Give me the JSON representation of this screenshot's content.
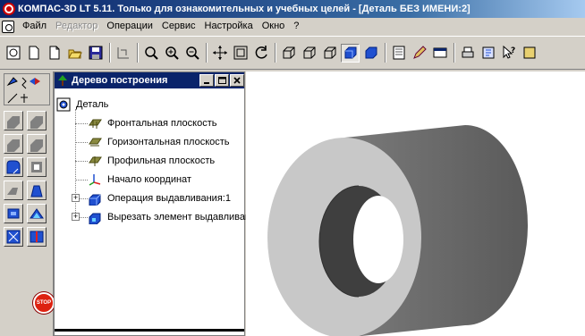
{
  "window": {
    "title": "КОМПАС-3D LT 5.11. Только для ознакомительных и учебных целей - [Деталь БЕЗ ИМЕНИ:2]",
    "app_icon": "kompas-logo-icon"
  },
  "menu": {
    "doc_icon": "document-window-icon",
    "items": [
      {
        "label": "Файл",
        "enabled": true
      },
      {
        "label": "Редактор",
        "enabled": false
      },
      {
        "label": "Операции",
        "enabled": true
      },
      {
        "label": "Сервис",
        "enabled": true
      },
      {
        "label": "Настройка",
        "enabled": true
      },
      {
        "label": "Окно",
        "enabled": true
      },
      {
        "label": "?",
        "enabled": true
      }
    ]
  },
  "toolbar": {
    "buttons": [
      "new-part-icon",
      "new-document-icon",
      "new-sheet-icon",
      "open-icon",
      "save-icon",
      "print-preview-icon",
      "zoom-frame-icon",
      "zoom-in-icon",
      "zoom-out-icon",
      "pan-icon",
      "fit-all-icon",
      "rotate-icon",
      "wireframe-icon",
      "hidden-lines-icon",
      "no-hidden-lines-icon",
      "shaded-icon",
      "perspective-icon",
      "properties-icon",
      "edit-icon",
      "panel-icon",
      "print-icon",
      "library-icon",
      "help-pointer-icon",
      "export-icon"
    ],
    "pressed": "shaded-icon"
  },
  "tree": {
    "title": "Дерево построения",
    "root": "Деталь",
    "items": [
      {
        "label": "Фронтальная плоскость",
        "icon": "plane-icon",
        "expandable": false
      },
      {
        "label": "Горизонтальная плоскость",
        "icon": "plane-icon",
        "expandable": false
      },
      {
        "label": "Профильная плоскость",
        "icon": "plane-icon",
        "expandable": false
      },
      {
        "label": "Начало координат",
        "icon": "origin-axes-icon",
        "expandable": false
      },
      {
        "label": "Операция выдавливания:1",
        "icon": "extrude-icon",
        "expandable": true
      },
      {
        "label": "Вырезать элемент выдавливания",
        "icon": "cut-extrude-icon",
        "expandable": true
      }
    ]
  },
  "colors": {
    "title_active": "#0a246a",
    "model_light": "#c8c8c8",
    "model_dark": "#6a6a6a",
    "model_hole": "#3f3f3f"
  }
}
